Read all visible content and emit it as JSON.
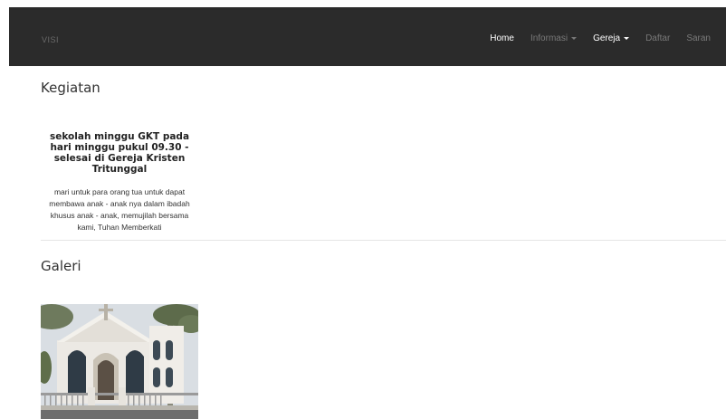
{
  "navbar": {
    "brand": "VISI",
    "items": [
      {
        "label": "Home",
        "state": "active",
        "dropdown": false
      },
      {
        "label": "Informasi",
        "state": "normal",
        "dropdown": true
      },
      {
        "label": "Gereja",
        "state": "highlight",
        "dropdown": true
      },
      {
        "label": "Daftar",
        "state": "normal",
        "dropdown": false
      },
      {
        "label": "Saran",
        "state": "normal",
        "dropdown": false
      }
    ]
  },
  "kegiatan": {
    "title": "Kegiatan",
    "event": {
      "heading": "sekolah minggu GKT pada hari minggu pukul 09.30 - selesai di Gereja Kristen Tritunggal",
      "text": "mari untuk para orang tua untuk dapat membawa anak - anak nya dalam ibadah khusus anak - anak, memujilah bersama kami, Tuhan Memberkati"
    }
  },
  "galeri": {
    "title": "Galeri",
    "photo": "church-photo"
  },
  "colors": {
    "navbar_bg": "#2b2b2b",
    "nav_active": "#ffffff",
    "nav_inactive": "#7a7a7a"
  }
}
